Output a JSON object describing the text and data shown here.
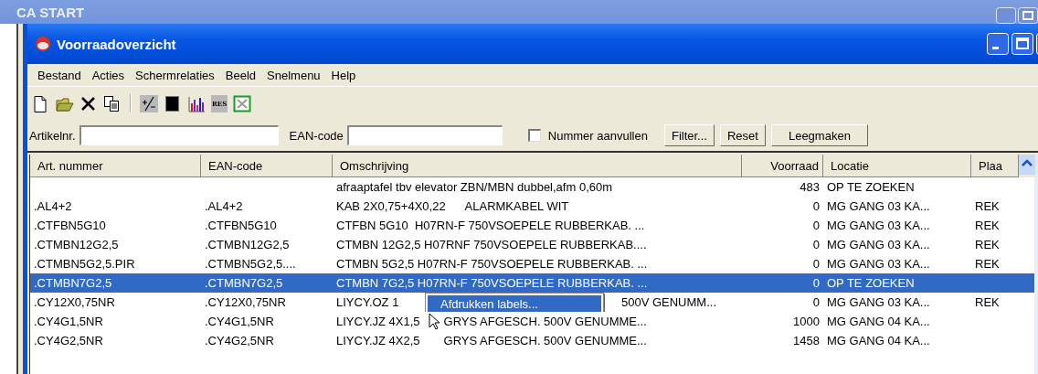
{
  "background_window": {
    "title": "CA START"
  },
  "window": {
    "title": "Voorraadoverzicht"
  },
  "menu": [
    "Bestand",
    "Acties",
    "Schermrelaties",
    "Beeld",
    "Snelmenu",
    "Help"
  ],
  "toolbar": [
    {
      "kind": "new"
    },
    {
      "kind": "open"
    },
    {
      "kind": "delete"
    },
    {
      "kind": "copy"
    },
    {
      "kind": "separator"
    },
    {
      "kind": "plusminus"
    },
    {
      "kind": "black"
    },
    {
      "kind": "chart"
    },
    {
      "kind": "res",
      "label": "RES"
    },
    {
      "kind": "excel"
    }
  ],
  "filters": {
    "artikelnr_label": "Artikelnr.",
    "ean_label": "EAN-code",
    "checkbox": {
      "label": "Nummer aanvullen",
      "checked": false
    },
    "buttons": [
      "Filter...",
      "Reset",
      "Leegmaken"
    ]
  },
  "table": {
    "columns": [
      "Art. nummer",
      "EAN-code",
      "Omschrijving",
      "Voorraad",
      "Locatie",
      "Plaa"
    ],
    "rows": [
      {
        "selected": false,
        "cells": [
          "",
          "",
          "afraaptafel tbv elevator ZBN/MBN dubbel,afm 0,60m",
          "483",
          "OP TE ZOEKEN",
          ""
        ]
      },
      {
        "selected": false,
        "cells": [
          ".AL4+2",
          ".AL4+2",
          "KAB 2X0,75+4X0,22      ALARMKABEL WIT",
          "0",
          "MG GANG 03 KA...",
          "REK"
        ]
      },
      {
        "selected": false,
        "cells": [
          ".CTFBN5G10",
          ".CTFBN5G10",
          "CTFBN 5G10  H07RN-F 750VSOEPELE RUBBERKAB. ...",
          "0",
          "MG GANG 03 KA...",
          "REK"
        ]
      },
      {
        "selected": false,
        "cells": [
          ".CTMBN12G2,5",
          ".CTMBN12G2,5",
          "CTMBN 12G2,5 H07RNF 750VSOEPELE RUBBERKAB....",
          "0",
          "MG GANG 03 KA...",
          "REK"
        ]
      },
      {
        "selected": false,
        "cells": [
          ".CTMBN5G2,5.PIR",
          ".CTMBN5G2,5....",
          "CTMBN 5G2,5 H07RN-F 750VSOEPELE RUBBERKAB. ...",
          "0",
          "MG GANG 03 KA...",
          "REK"
        ]
      },
      {
        "selected": true,
        "cells": [
          ".CTMBN7G2,5",
          ".CTMBN7G2,5",
          "CTMBN 7G2,5 H07RN-F 750VSOEPELE RUBBERKAB. ...",
          "0",
          "OP TE ZOEKEN",
          ""
        ]
      },
      {
        "selected": false,
        "cells": [
          ".CY12X0,75NR",
          ".CY12X0,75NR",
          {
            "kind": "covered",
            "parts": [
              "LIYCY.OZ 1",
              "500V GENUMM..."
            ]
          },
          "0",
          "MG GANG 03 KA...",
          "REK"
        ]
      },
      {
        "selected": false,
        "cells": [
          ".CY4G1,5NR",
          ".CY4G1,5NR",
          [
            "LIYCY.JZ 4X1,5",
            "GRYS AFGESCH. 500V GENUMME..."
          ],
          "1000",
          "MG GANG 04 KA...",
          ""
        ]
      },
      {
        "selected": false,
        "cells": [
          ".CY4G2,5NR",
          ".CY4G2,5NR",
          [
            "LIYCY.JZ 4X2,5",
            "GRYS AFGESCH. 500V GENUMME..."
          ],
          "1458",
          "MG GANG 04 KA...",
          ""
        ]
      }
    ]
  },
  "context_menu": {
    "items": [
      {
        "label": "Afdrukken labels...",
        "selected": true
      }
    ]
  }
}
